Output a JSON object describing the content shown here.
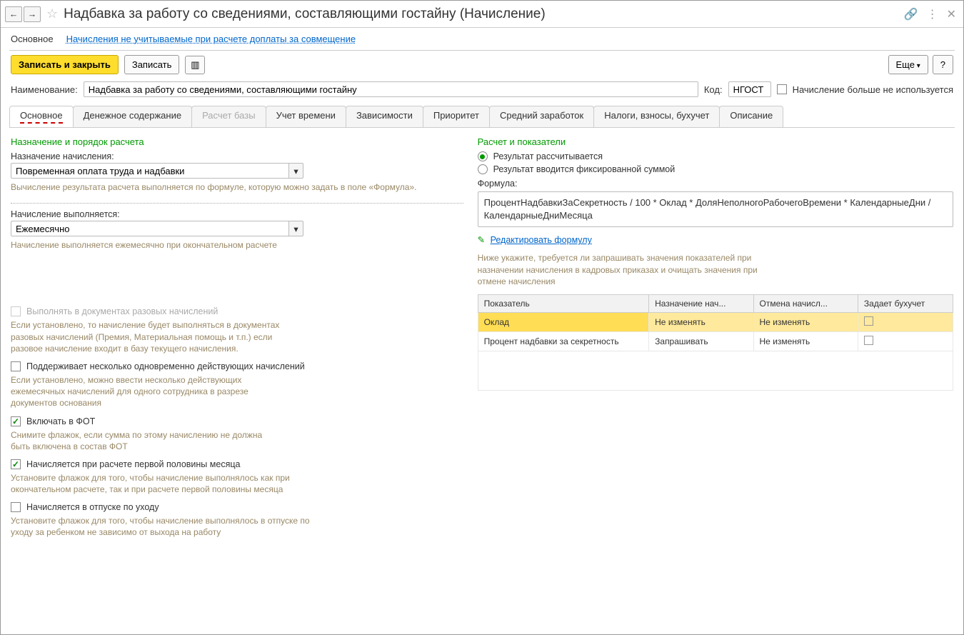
{
  "title": "Надбавка за работу со сведениями, составляющими гостайну (Начисление)",
  "subnav": {
    "main": "Основное",
    "link": "Начисления не учитываемые при расчете доплаты за совмещение"
  },
  "toolbar": {
    "save_close": "Записать и закрыть",
    "save": "Записать",
    "more": "Еще",
    "help": "?"
  },
  "form": {
    "name_label": "Наименование:",
    "name_value": "Надбавка за работу со сведениями, составляющими гостайну",
    "code_label": "Код:",
    "code_value": "НГОСТ",
    "not_used_label": "Начисление больше не используется"
  },
  "tabs": [
    "Основное",
    "Денежное содержание",
    "Расчет базы",
    "Учет времени",
    "Зависимости",
    "Приоритет",
    "Средний заработок",
    "Налоги, взносы, бухучет",
    "Описание"
  ],
  "left": {
    "section1": "Назначение и порядок расчета",
    "purpose_label": "Назначение начисления:",
    "purpose_value": "Повременная оплата труда и надбавки",
    "purpose_help": "Вычисление результата расчета выполняется по формуле, которую можно задать в поле «Формула».",
    "perform_label": "Начисление выполняется:",
    "perform_value": "Ежемесячно",
    "perform_help": "Начисление выполняется ежемесячно при окончательном расчете",
    "chk1": "Выполнять в документах разовых начислений",
    "chk1_help": "Если установлено, то начисление будет выполняться в документах разовых начислений (Премия, Материальная помощь и т.п.) если разовое начисление входит в базу текущего начисления.",
    "chk2": "Поддерживает несколько одновременно действующих начислений",
    "chk2_help": "Если установлено, можно ввести несколько действующих ежемесячных начислений для одного сотрудника в разрезе документов основания",
    "chk3": "Включать в ФОТ",
    "chk3_help": "Снимите флажок, если сумма по этому начислению не должна быть включена в состав ФОТ",
    "chk4": "Начисляется при расчете первой половины месяца",
    "chk4_help": "Установите флажок для того, чтобы начисление выполнялось как при окончательном расчете, так и при расчете первой половины месяца",
    "chk5": "Начисляется в отпуске по уходу",
    "chk5_help": "Установите флажок для того, чтобы начисление выполнялось в отпуске по уходу за ребенком не зависимо от выхода на работу"
  },
  "right": {
    "section": "Расчет и показатели",
    "radio1": "Результат рассчитывается",
    "radio2": "Результат вводится фиксированной суммой",
    "formula_label": "Формула:",
    "formula": "ПроцентНадбавкиЗаСекретность / 100 * Оклад * ДоляНеполногоРабочегоВремени * КалендарныеДни / КалендарныеДниМесяца",
    "edit_link": "Редактировать формулу",
    "help": "Ниже укажите, требуется ли запрашивать значения показателей при назначении начисления в кадровых приказах и очищать значения при отмене начисления",
    "headers": [
      "Показатель",
      "Назначение нач...",
      "Отмена начисл...",
      "Задает бухучет"
    ],
    "rows": [
      {
        "name": "Оклад",
        "assign": "Не изменять",
        "cancel": "Не изменять"
      },
      {
        "name": "Процент надбавки за секретность",
        "assign": "Запрашивать",
        "cancel": "Не изменять"
      }
    ]
  }
}
